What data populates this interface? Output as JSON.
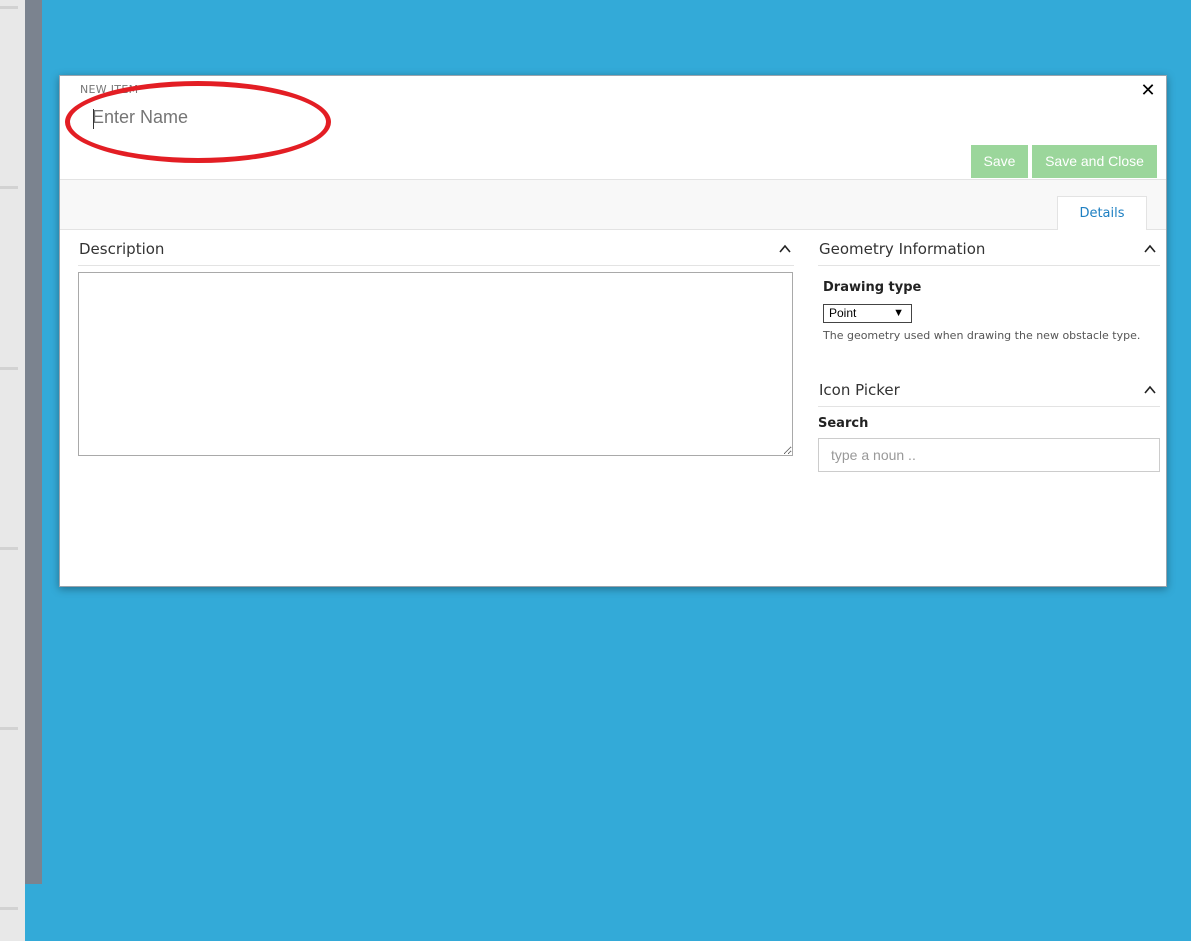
{
  "dialog": {
    "header_label": "NEW ITEM",
    "name_placeholder": "Enter Name",
    "save_label": "Save",
    "save_close_label": "Save and Close",
    "close_icon": "close-icon",
    "tabs": [
      {
        "label": "Details",
        "active": true
      }
    ]
  },
  "description": {
    "title": "Description",
    "value": ""
  },
  "geometry": {
    "title": "Geometry Information",
    "drawing_type_label": "Drawing type",
    "drawing_type_value": "Point",
    "help": "The geometry used when drawing the new obstacle type."
  },
  "icon_picker": {
    "title": "Icon Picker",
    "search_label": "Search",
    "search_placeholder": "type a noun .."
  },
  "colors": {
    "background": "#33aad8",
    "button_green": "#9bd69b",
    "tab_link": "#1d7fc2",
    "annotation_red": "#e31e24"
  }
}
